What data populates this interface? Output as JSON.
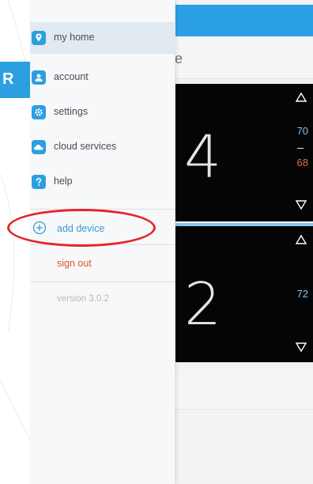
{
  "corner_tab": {
    "letter": "R"
  },
  "drawer": {
    "items": [
      {
        "label": "my home",
        "icon": "location-pin-icon",
        "active": true
      },
      {
        "label": "account",
        "icon": "person-card-icon",
        "active": false
      },
      {
        "label": "settings",
        "icon": "gear-icon",
        "active": false
      },
      {
        "label": "cloud services",
        "icon": "cloud-icon",
        "active": false
      },
      {
        "label": "help",
        "icon": "question-icon",
        "active": false
      }
    ],
    "add_device": "add device",
    "sign_out": "sign out",
    "version": "version 3.0.2"
  },
  "app": {
    "subtitle_fragment": "e",
    "thermostats": [
      {
        "temperature": "4",
        "cool_setpoint": "70",
        "separator": "–",
        "heat_setpoint": "68"
      },
      {
        "temperature": "2",
        "cool_setpoint": "72"
      }
    ]
  },
  "colors": {
    "accent_blue": "#2b9fe0",
    "highlight_red": "#e5242b",
    "sign_out_orange": "#e2552e",
    "heat_setpoint": "#e06a4a",
    "cool_setpoint": "#8fbfe3"
  }
}
